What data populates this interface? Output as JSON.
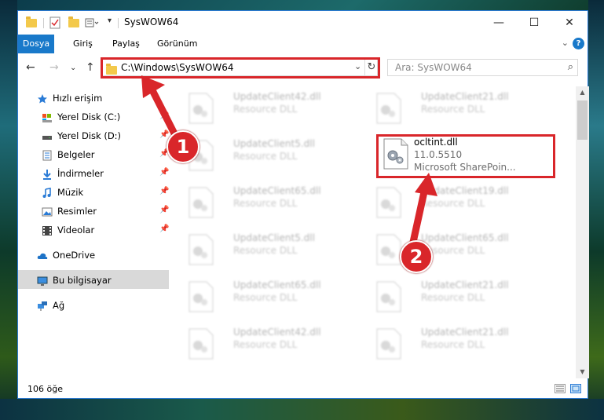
{
  "window": {
    "title": "SysWOW64"
  },
  "ribbon": {
    "tabs": [
      "Dosya",
      "Giriş",
      "Paylaş",
      "Görünüm"
    ],
    "help": "?"
  },
  "address": {
    "path": "C:\\Windows\\SysWOW64"
  },
  "search": {
    "placeholder": "Ara: SysWOW64"
  },
  "sidebar": {
    "items": [
      {
        "label": "Hızlı erişim",
        "icon": "star-icon",
        "pinned": false
      },
      {
        "label": "Yerel Disk (C:)",
        "icon": "drive-icon",
        "pinned": true
      },
      {
        "label": "Yerel Disk (D:)",
        "icon": "drive-icon",
        "pinned": true
      },
      {
        "label": "Belgeler",
        "icon": "documents-icon",
        "pinned": true
      },
      {
        "label": "İndirmeler",
        "icon": "download-icon",
        "pinned": true
      },
      {
        "label": "Müzik",
        "icon": "music-icon",
        "pinned": true
      },
      {
        "label": "Resimler",
        "icon": "pictures-icon",
        "pinned": true
      },
      {
        "label": "Videolar",
        "icon": "videos-icon",
        "pinned": true
      },
      {
        "label": "OneDrive",
        "icon": "cloud-icon",
        "pinned": false
      },
      {
        "label": "Bu bilgisayar",
        "icon": "computer-icon",
        "pinned": false
      },
      {
        "label": "Ağ",
        "icon": "network-icon",
        "pinned": false
      }
    ]
  },
  "files": [
    {
      "name": "UpdateClient42.dll",
      "type": "Resource DLL"
    },
    {
      "name": "UpdateClient21.dll",
      "type": "Resource DLL"
    },
    {
      "name": "UpdateClient5.dll",
      "type": "Resource DLL"
    },
    {
      "name": "ocltint.dll",
      "type": "11.0.5510",
      "desc": "Microsoft SharePoin..."
    },
    {
      "name": "UpdateClient65.dll",
      "type": "Resource DLL"
    },
    {
      "name": "UpdateClient19.dll",
      "type": "Resource DLL"
    },
    {
      "name": "UpdateClient5.dll",
      "type": "Resource DLL"
    },
    {
      "name": "UpdateClient65.dll",
      "type": "Resource DLL"
    },
    {
      "name": "UpdateClient65.dll",
      "type": "Resource DLL"
    },
    {
      "name": "UpdateClient21.dll",
      "type": "Resource DLL"
    },
    {
      "name": "UpdateClient42.dll",
      "type": "Resource DLL"
    },
    {
      "name": "UpdateClient21.dll",
      "type": "Resource DLL"
    }
  ],
  "status": {
    "count": "106 öğe"
  },
  "annotations": {
    "step1": "1",
    "step2": "2",
    "color": "#d9262a"
  }
}
